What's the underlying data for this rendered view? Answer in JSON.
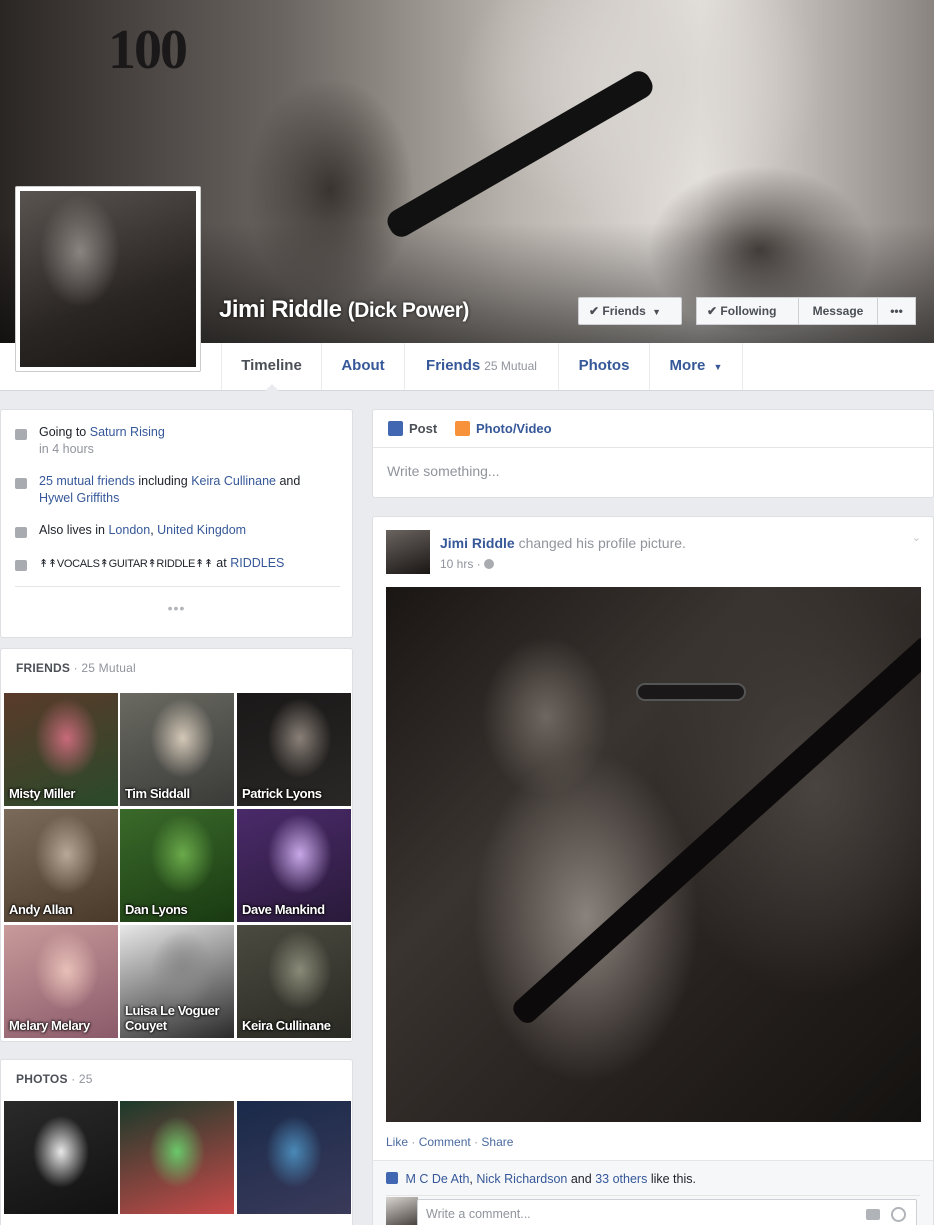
{
  "profile": {
    "name": "Jimi Riddle",
    "alt_name": "(Dick Power)",
    "cover_text": "100"
  },
  "cover_buttons": {
    "friends": "Friends",
    "following": "Following",
    "message": "Message",
    "more": "•••"
  },
  "nav": {
    "timeline": "Timeline",
    "about": "About",
    "friends": "Friends",
    "friends_sub": "25 Mutual",
    "photos": "Photos",
    "more": "More"
  },
  "intro": {
    "going_to": "Going to",
    "event": "Saturn Rising",
    "event_time": "in 4 hours",
    "mutual_link": "25 mutual friends",
    "mutual_including": "including",
    "mutual_friend1": "Keira Cullinane",
    "mutual_and": "and",
    "mutual_friend2": "Hywel Griffiths",
    "lives_prefix": "Also lives in",
    "lives_city": "London",
    "lives_country": "United Kingdom",
    "work_title": "↟↟VOCALS↟GUITAR↟RIDDLE↟↟",
    "work_at": "at",
    "work_place": "RIDDLES",
    "more_dots": "•••"
  },
  "friends_section": {
    "title": "FRIENDS",
    "count": " · 25 Mutual",
    "friends": [
      {
        "name": "Misty Miller",
        "colors": [
          "#5a3a2a",
          "#c86a7a",
          "#2a4a2a"
        ]
      },
      {
        "name": "Tim Siddall",
        "colors": [
          "#6a6a62",
          "#d4c8b8",
          "#3a3a38"
        ]
      },
      {
        "name": "Patrick Lyons",
        "colors": [
          "#1a1818",
          "#8a8078",
          "#2a2826"
        ]
      },
      {
        "name": "Andy Allan",
        "colors": [
          "#7a6a5a",
          "#b8a898",
          "#4a3a2a"
        ]
      },
      {
        "name": "Dan Lyons",
        "colors": [
          "#3a6a2a",
          "#6aaa4a",
          "#1a3a12"
        ]
      },
      {
        "name": "Dave Mankind",
        "colors": [
          "#4a2a6a",
          "#c8a8e8",
          "#2a1a3a"
        ]
      },
      {
        "name": "Melary Melary",
        "colors": [
          "#c89a9a",
          "#e8c0b8",
          "#8a5a6a"
        ]
      },
      {
        "name": "Luisa Le Voguer Couyet",
        "colors": [
          "#e8e8e8",
          "#888888",
          "#2a2a2a"
        ]
      },
      {
        "name": "Keira Cullinane",
        "colors": [
          "#4a4a40",
          "#8a8a78",
          "#2a2a24"
        ]
      }
    ]
  },
  "photos_section": {
    "title": "PHOTOS",
    "count": " · 25",
    "photos": [
      {
        "colors": [
          "#2a2a2a",
          "#e8e8e8",
          "#111111"
        ]
      },
      {
        "colors": [
          "#1a3a2a",
          "#6ac86a",
          "#c84a4a"
        ]
      },
      {
        "colors": [
          "#1a2a4a",
          "#4a8ab8",
          "#3a3a5a"
        ]
      }
    ]
  },
  "composer": {
    "post_tab": "Post",
    "photo_tab": "Photo/Video",
    "placeholder": "Write something..."
  },
  "post": {
    "author": "Jimi Riddle",
    "action": "changed his profile picture.",
    "time": "10 hrs",
    "like": "Like",
    "comment": "Comment",
    "share": "Share",
    "liker1": "M C De Ath",
    "liker2": "Nick Richardson",
    "likes_and": "and",
    "likes_others": "33 others",
    "likes_suffix": "like this.",
    "comment_placeholder": "Write a comment..."
  },
  "colors": {
    "link": "#365899",
    "page_bg": "#e9ebee"
  }
}
